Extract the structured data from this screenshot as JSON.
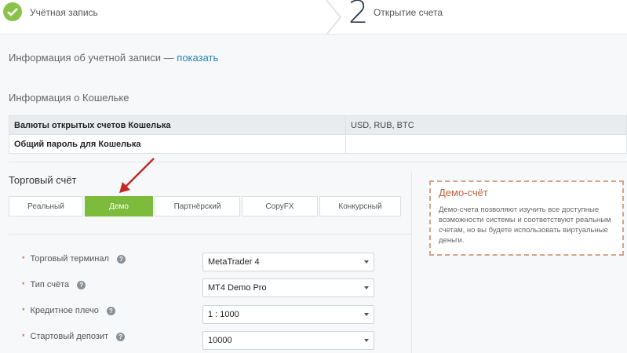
{
  "steps": {
    "step1_label": "Учётная запись",
    "step2_number": "2",
    "step2_label": "Открытие счета"
  },
  "account_info": {
    "text": "Информация об учетной записи — ",
    "link": "показать"
  },
  "wallet": {
    "title": "Информация о Кошельке",
    "rows": [
      {
        "key": "Валюты открытых счетов Кошелька",
        "value": "USD, RUB, BTC"
      },
      {
        "key": "Общий пароль для Кошелька",
        "value": ""
      }
    ]
  },
  "trading": {
    "title": "Торговый счёт",
    "tabs": [
      "Реальный",
      "Демо",
      "Партнёрский",
      "CopyFX",
      "Конкурсный"
    ],
    "active_tab": "Демо"
  },
  "form": {
    "fields": [
      {
        "label": "Торговый терминал",
        "value": "MetaTrader 4"
      },
      {
        "label": "Тип счёта",
        "value": "MT4 Demo Pro"
      },
      {
        "label": "Кредитное плечо",
        "value": "1 : 1000"
      },
      {
        "label": "Стартовый депозит",
        "value": "10000"
      }
    ],
    "help_glyph": "?",
    "required_mark": "*"
  },
  "demo_info": {
    "title": "Демо-счёт",
    "text": "Демо-счета позволяют изучить все доступные возможности системы и соответствуют реальным счетам, но вы будете использовать виртуальные деньги."
  },
  "colors": {
    "accent_green": "#7dbb3c",
    "link_blue": "#2980b9",
    "arrow_red": "#c62828",
    "demo_border": "#d9a28a"
  },
  "icons": [
    "check-icon",
    "chevron-right-icon",
    "help-icon",
    "caret-down-icon",
    "arrow-pointer-icon"
  ]
}
